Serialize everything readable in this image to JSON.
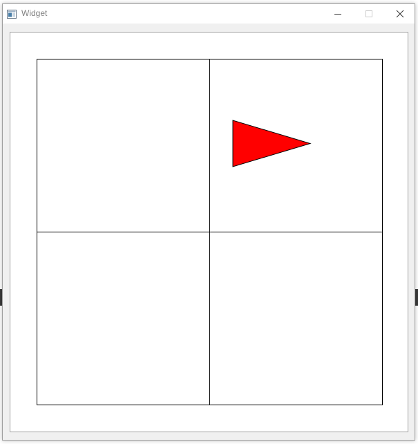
{
  "window": {
    "title": "Widget",
    "icon": "app-window-icon",
    "controls": [
      "minimize-icon",
      "maximize-icon",
      "close-icon"
    ]
  },
  "canvas": {
    "grid": {
      "rows": 2,
      "columns": 2
    },
    "shape": {
      "type": "triangle",
      "points": [
        [
          0.134,
          0.354
        ],
        [
          0.134,
          0.622
        ],
        [
          0.582,
          0.488
        ]
      ],
      "fill": "#ff0000",
      "stroke": "#000000"
    }
  },
  "colors": {
    "window_bg": "#f0f0f0",
    "titlebar_bg": "#ffffff",
    "canvas_bg": "#ffffff",
    "grid_line": "#000000"
  }
}
